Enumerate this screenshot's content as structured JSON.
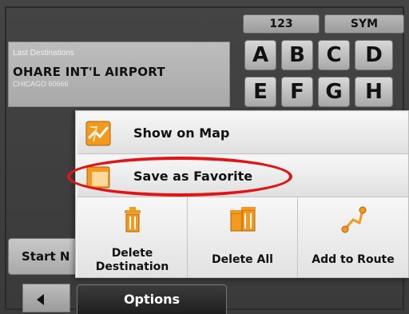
{
  "last_destinations": {
    "label": "Last Destinations",
    "name": "OHARE INT'L AIRPORT",
    "address": "CHICAGO 60666"
  },
  "keyboard": {
    "tabs": [
      "123",
      "SYM"
    ],
    "keys": [
      "A",
      "B",
      "C",
      "D",
      "E",
      "F",
      "G",
      "H"
    ]
  },
  "start_button": {
    "label": "Start N"
  },
  "options_menu": {
    "items": [
      {
        "label": "Show on Map",
        "icon": "map-icon"
      },
      {
        "label": "Save as Favorite",
        "icon": "favorite-folder-icon"
      }
    ],
    "actions": [
      {
        "label": "Delete Destination",
        "line1": "Delete",
        "line2": "Destination",
        "icon": "trash-can-icon"
      },
      {
        "label": "Delete All",
        "icon": "trash-cans-icon"
      },
      {
        "label": "Add to Route",
        "icon": "route-icon"
      }
    ],
    "tab_label": "Options"
  },
  "colors": {
    "highlight": "#e01515",
    "icon_orange": "#f39a1e"
  }
}
